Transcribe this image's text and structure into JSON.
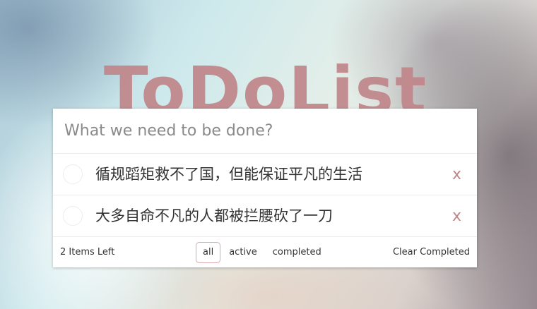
{
  "app": {
    "title": "ToDoList"
  },
  "new_todo": {
    "placeholder": "What we need to be done?",
    "value": ""
  },
  "todos": [
    {
      "text": "循规蹈矩救不了国，但能保证平凡的生活",
      "completed": false,
      "delete_label": "x"
    },
    {
      "text": "大多自命不凡的人都被拦腰砍了一刀",
      "completed": false,
      "delete_label": "x"
    }
  ],
  "footer": {
    "items_left": "2 Items Left",
    "filters": [
      {
        "label": "all",
        "selected": true
      },
      {
        "label": "active",
        "selected": false
      },
      {
        "label": "completed",
        "selected": false
      }
    ],
    "clear_label": "Clear Completed"
  },
  "colors": {
    "accent": "#c0868a",
    "filter_border": "#d9a8ab"
  }
}
